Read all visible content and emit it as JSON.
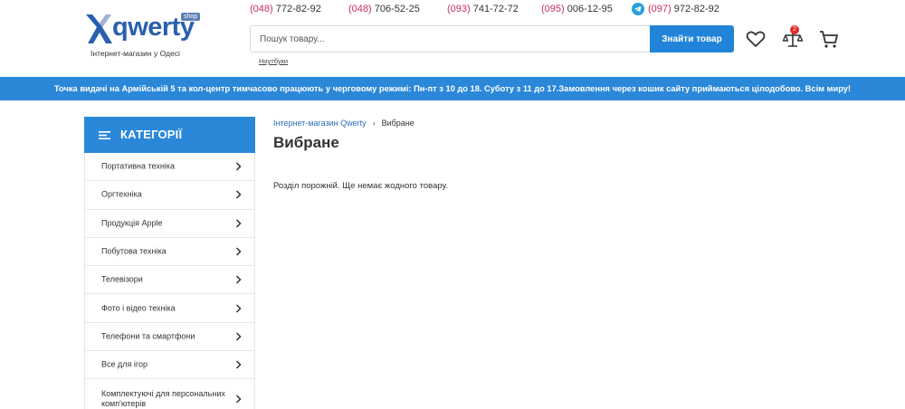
{
  "logo": {
    "word": "qwerty",
    "badge": "shop",
    "tagline": "Інтернет-магазин у Одесі"
  },
  "phones": [
    {
      "code": "(048)",
      "number": "772-82-92"
    },
    {
      "code": "(048)",
      "number": "706-52-25"
    },
    {
      "code": "(093)",
      "number": "741-72-72"
    },
    {
      "code": "(095)",
      "number": "006-12-95"
    },
    {
      "code": "(097)",
      "number": "972-82-92"
    }
  ],
  "search": {
    "placeholder": "Пошук товару...",
    "value": "",
    "button_label": "Знайти товар",
    "hint": "Ноутбуки"
  },
  "header_icons": {
    "wishlist": "heart-icon",
    "compare": "scales-icon",
    "compare_count": "2",
    "cart": "cart-icon"
  },
  "announcement": "Точка видачі на Армійській 5 та кол-центр тимчасово працюють у черговому режимі: Пн-пт з 10 до 18. Суботу з 11 до 17.Замовлення через кошик сайту приймаються цілодобово. Всім миру!",
  "sidebar": {
    "title": "КАТЕГОРІЇ",
    "items": [
      {
        "label": "Портативна техніка"
      },
      {
        "label": "Оргтехніка"
      },
      {
        "label": "Продукція Apple"
      },
      {
        "label": "Побутова техніка"
      },
      {
        "label": "Телевізори"
      },
      {
        "label": "Фото і відео техніка"
      },
      {
        "label": "Телефони та смартфони"
      },
      {
        "label": "Все для ігор"
      },
      {
        "label": "Комплектуючі для персональних комп'ютерів"
      }
    ]
  },
  "breadcrumb": {
    "home": "Інтернет-магазин Qwerty",
    "current": "Вибране"
  },
  "page": {
    "title": "Вибране",
    "empty_message": "Розділ порожній. Ще немає жодного товару."
  },
  "colors": {
    "accent": "#2b88d9",
    "phone_code": "#c6315a",
    "logo": "#2a5fae",
    "badge": "#e02a2a"
  }
}
